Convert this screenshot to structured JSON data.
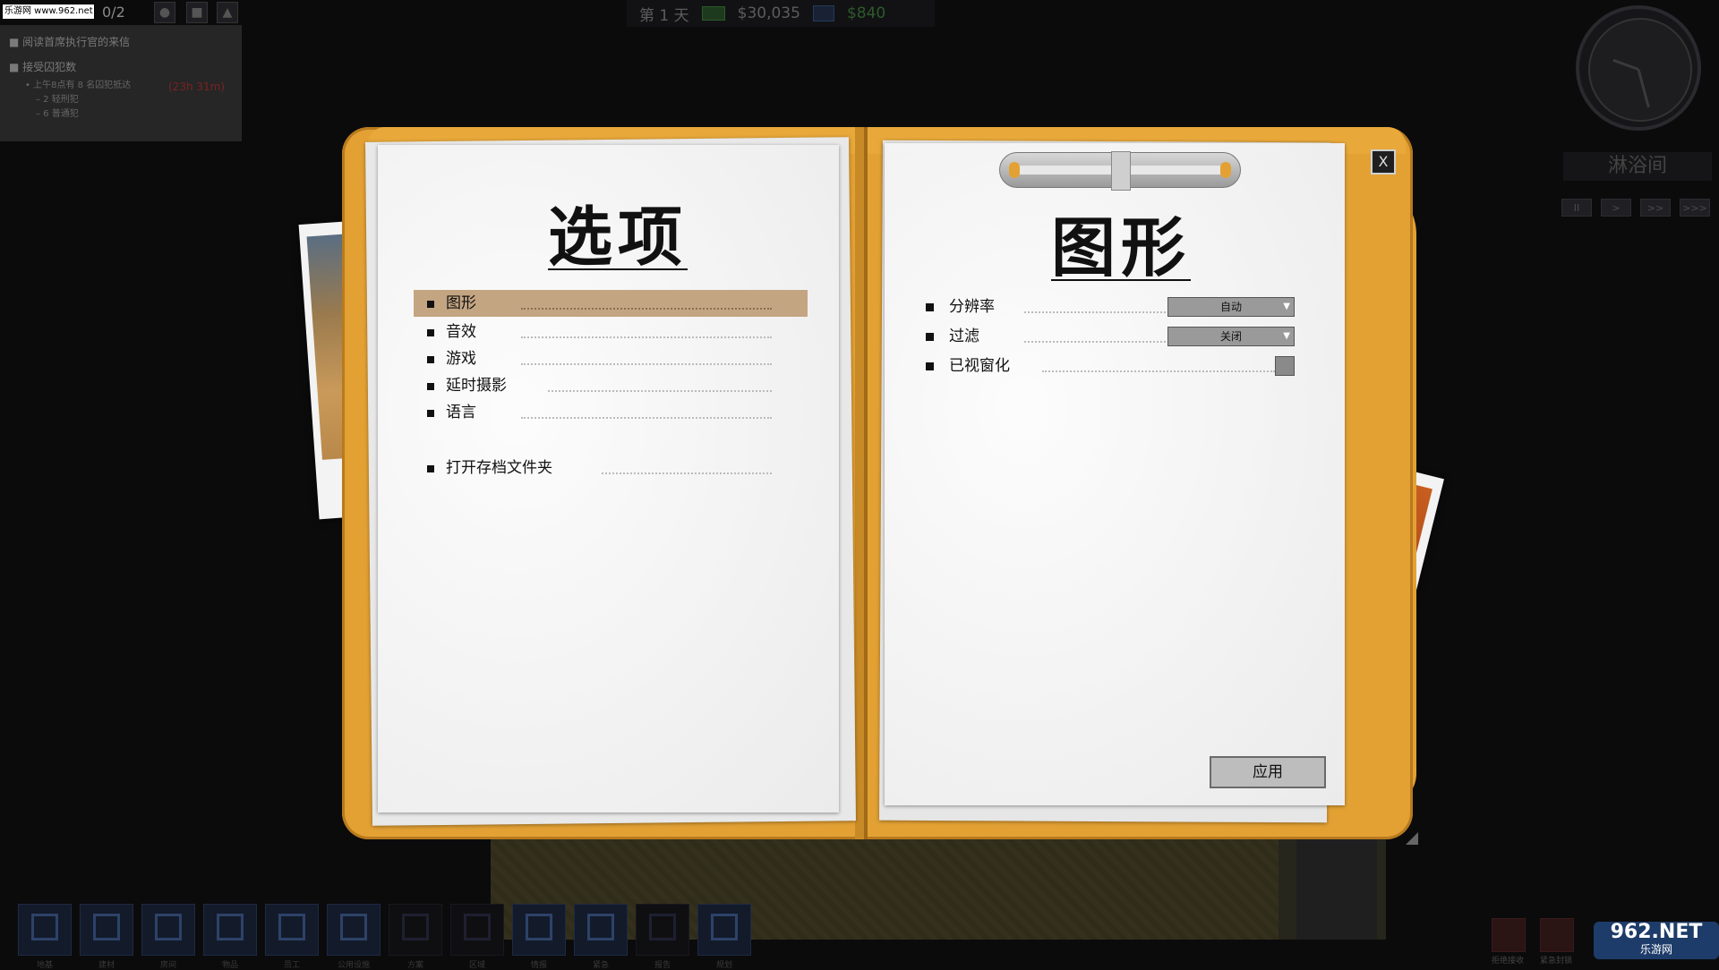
{
  "hud": {
    "logo_badge": "乐游网 www.962.net",
    "objective_count": "0/2",
    "objectives": [
      {
        "text": "■ 阅读首席执行官的来信"
      },
      {
        "text": "■ 接受囚犯数"
      },
      {
        "text": "• 上午8点有 8 名囚犯抵达"
      },
      {
        "text": "– 2 轻刑犯"
      },
      {
        "text": "– 6 普通犯"
      }
    ],
    "objective_timer": "(23h 31m)",
    "day_label": "第 1 天",
    "balance": "$30,035",
    "income": "$840",
    "room_name": "淋浴间",
    "speed_buttons": [
      "II",
      ">",
      ">>",
      ">>>"
    ]
  },
  "options": {
    "title": "选项",
    "menu": [
      {
        "label": "图形",
        "active": true
      },
      {
        "label": "音效",
        "active": false
      },
      {
        "label": "游戏",
        "active": false
      },
      {
        "label": "延时摄影",
        "active": false
      },
      {
        "label": "语言",
        "active": false
      }
    ],
    "open_save_folder": "打开存档文件夹"
  },
  "graphics": {
    "title": "图形",
    "settings": [
      {
        "label": "分辨率",
        "type": "select",
        "value": "自动"
      },
      {
        "label": "过滤",
        "type": "select",
        "value": "关闭"
      },
      {
        "label": "已视窗化",
        "type": "checkbox",
        "value": ""
      }
    ],
    "apply_label": "应用",
    "close_label": "X"
  },
  "toolbar": {
    "items": [
      {
        "label": "地基"
      },
      {
        "label": "建材"
      },
      {
        "label": "房间"
      },
      {
        "label": "物品"
      },
      {
        "label": "员工"
      },
      {
        "label": "公用设施"
      },
      {
        "label": "方案"
      },
      {
        "label": "区域"
      },
      {
        "label": "情报"
      },
      {
        "label": "紧急"
      },
      {
        "label": "报告"
      },
      {
        "label": "规划"
      }
    ],
    "right_items": [
      {
        "label": "拒绝接收"
      },
      {
        "label": "紧急封锁"
      }
    ]
  },
  "watermark": {
    "main": "962.NET",
    "sub": "乐游网"
  },
  "colors": {
    "folder": "#e3a134",
    "active_menu": "#c4a582",
    "background": "#0b0b0c"
  }
}
